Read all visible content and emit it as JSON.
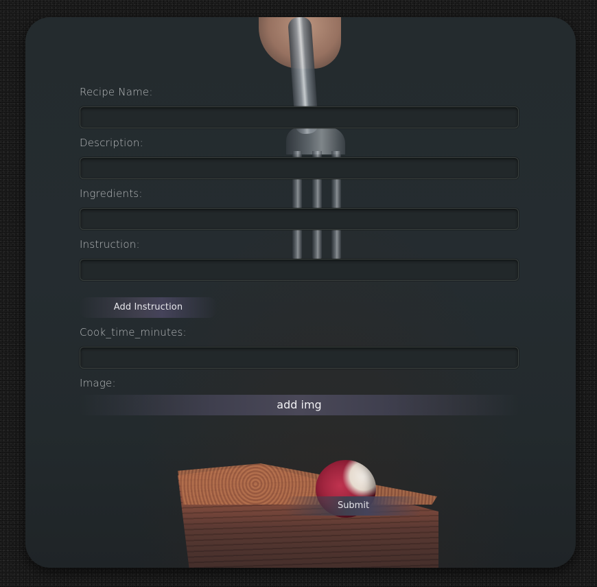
{
  "form": {
    "recipe_name_label": "Recipe Name:",
    "description_label": "Description:",
    "ingredients_label": "Ingredients:",
    "instruction_label": "Instruction:",
    "add_instruction_label": "Add Instruction",
    "cook_time_label": "Cook_time_minutes:",
    "image_label": "Image:",
    "add_img_label": "add img",
    "submit_label": "Submit"
  },
  "fields": {
    "recipe_name_value": "",
    "description_value": "",
    "ingredients_value": "",
    "instruction_value": "",
    "cook_time_value": ""
  },
  "colors": {
    "page_background": "#1c1c1c",
    "card_background": "#242b2e",
    "input_background": "#22282a",
    "button_gradient": "#45435a",
    "label_text": "#c7cacc"
  },
  "icons": {
    "background_photo": "fork-hand-cake-raspberry-photo"
  }
}
